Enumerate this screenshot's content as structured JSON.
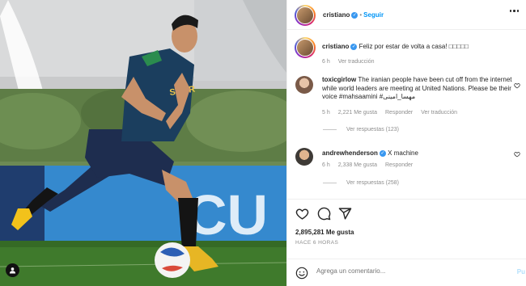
{
  "header": {
    "username": "cristiano",
    "follow_label": "Seguir",
    "separator": "•"
  },
  "caption": {
    "username": "cristiano",
    "text": "Feliz por estar de volta a casa! □□□□□",
    "time": "6 h",
    "translate_label": "Ver traducción"
  },
  "comments": [
    {
      "username": "toxicgirlow",
      "text": "The iranian people have been cut off from the internet while world leaders are meeting at United Nations. Please be their voice #mahsaamini #مهسا_امینی",
      "time": "5 h",
      "likes": "2,221 Me gusta",
      "reply_label": "Responder",
      "translate_label": "Ver traducción",
      "view_replies": "Ver respuestas (123)"
    },
    {
      "username": "andrewhenderson",
      "text": "X machine",
      "time": "6 h",
      "likes": "2,338 Me gusta",
      "reply_label": "Responder",
      "view_replies": "Ver respuestas (258)"
    }
  ],
  "post": {
    "likes": "2,895,281 Me gusta",
    "time_ago": "HACE 6 HORAS"
  },
  "composer": {
    "placeholder": "Agrega un comentario...",
    "post_label": "Pu"
  },
  "media": {
    "jersey_text": "SAGR",
    "board_text": "CU"
  },
  "icons": {
    "verified": "verified-badge-icon",
    "more": "more-options-icon",
    "heart": "heart-icon",
    "comment": "comment-bubble-icon",
    "share": "paper-plane-icon",
    "emoji": "emoji-smile-icon",
    "user": "user-silhouette-icon"
  },
  "colors": {
    "link_blue": "#0095f6",
    "verified_blue": "#3897f0",
    "muted": "#8e8e8e",
    "text": "#262626"
  }
}
